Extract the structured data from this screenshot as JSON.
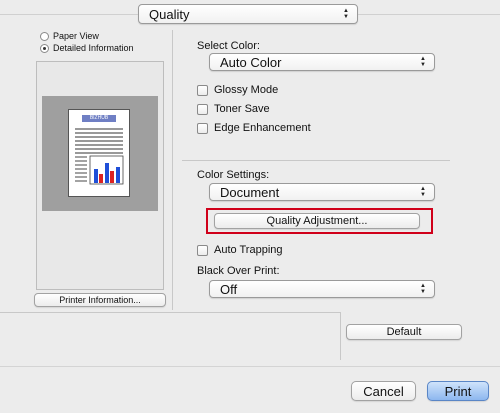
{
  "top_popup": {
    "value": "Quality"
  },
  "view_options": [
    {
      "label": "Paper View",
      "selected": false
    },
    {
      "label": "Detailed Information",
      "selected": true
    }
  ],
  "printer_info_button": "Printer Information...",
  "select_color": {
    "label": "Select Color:",
    "value": "Auto Color"
  },
  "checkboxes_top": [
    {
      "label": "Glossy Mode",
      "checked": false
    },
    {
      "label": "Toner Save",
      "checked": false
    },
    {
      "label": "Edge Enhancement",
      "checked": false
    }
  ],
  "color_settings": {
    "label": "Color Settings:",
    "value": "Document"
  },
  "quality_adjustment_button": "Quality Adjustment...",
  "highlight_color": "#d0001a",
  "auto_trapping": {
    "label": "Auto Trapping",
    "checked": false
  },
  "black_over_print": {
    "label": "Black Over Print:",
    "value": "Off"
  },
  "default_button": "Default",
  "cancel_button": "Cancel",
  "print_button": "Print",
  "preview_doc_title": "BIZHUB"
}
